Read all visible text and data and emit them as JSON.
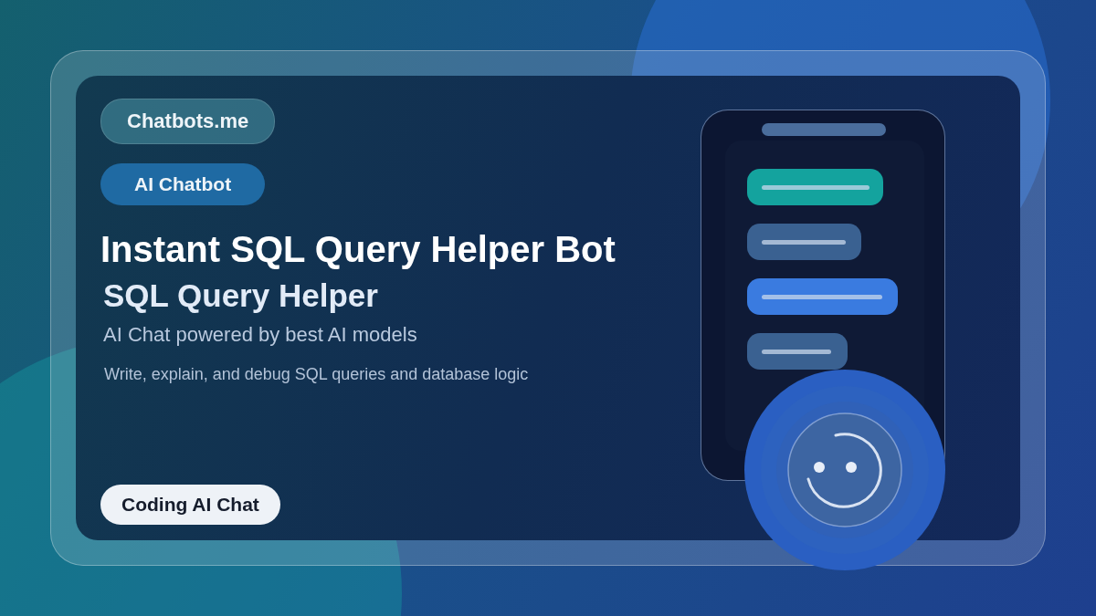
{
  "brand": "Chatbots.me",
  "category": "AI Chatbot",
  "title": "Instant SQL Query Helper Bot",
  "subtitle": "SQL Query Helper",
  "tagline": "AI Chat powered by best AI models",
  "description": "Write, explain, and debug SQL queries and database logic",
  "tag": "Coding AI Chat",
  "chat_bubbles": [
    {
      "color": "#14a39e"
    },
    {
      "color": "#3a6191"
    },
    {
      "color": "#3a7be0"
    },
    {
      "color": "#3a6191"
    }
  ]
}
